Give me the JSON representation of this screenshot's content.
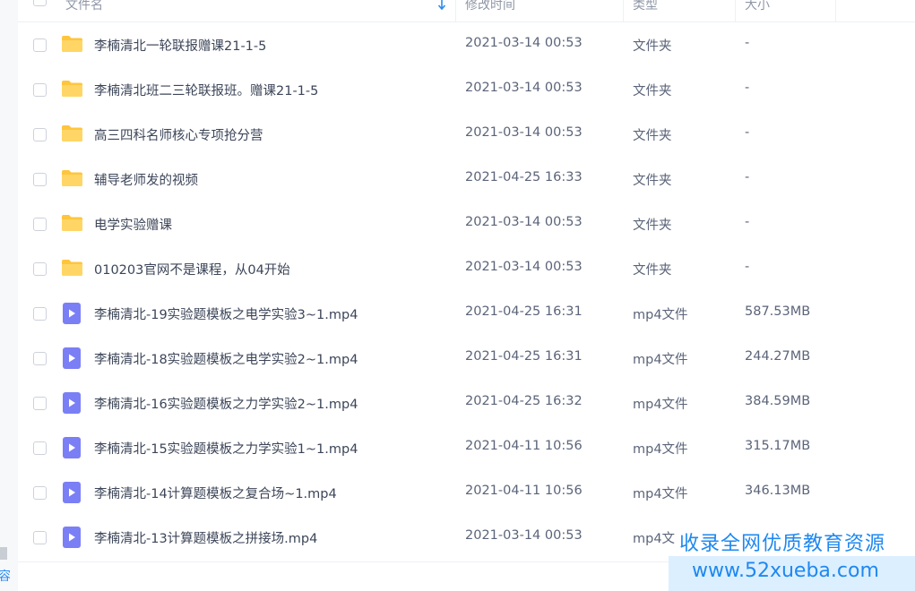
{
  "header": {
    "name_label": "文件名",
    "time_label": "修改时间",
    "type_label": "类型",
    "size_label": "大小",
    "sort_icon": "arrow-down-icon"
  },
  "rows": [
    {
      "name": "李楠清北一轮联报赠课21-1-5",
      "time": "2021-03-14 00:53",
      "type": "文件夹",
      "size": "-",
      "icon": "folder-icon"
    },
    {
      "name": "李楠清北班二三轮联报班。赠课21-1-5",
      "time": "2021-03-14 00:53",
      "type": "文件夹",
      "size": "-",
      "icon": "folder-icon"
    },
    {
      "name": "高三四科名师核心专项抢分营",
      "time": "2021-03-14 00:53",
      "type": "文件夹",
      "size": "-",
      "icon": "folder-icon"
    },
    {
      "name": "辅导老师发的视频",
      "time": "2021-04-25 16:33",
      "type": "文件夹",
      "size": "-",
      "icon": "folder-icon"
    },
    {
      "name": "电学实验赠课",
      "time": "2021-03-14 00:53",
      "type": "文件夹",
      "size": "-",
      "icon": "folder-icon"
    },
    {
      "name": "010203官网不是课程，从04开始",
      "time": "2021-03-14 00:53",
      "type": "文件夹",
      "size": "-",
      "icon": "folder-icon"
    },
    {
      "name": "李楠清北-19实验题模板之电学实验3~1.mp4",
      "time": "2021-04-25 16:31",
      "type": "mp4文件",
      "size": "587.53MB",
      "icon": "video-file-icon"
    },
    {
      "name": "李楠清北-18实验题模板之电学实验2~1.mp4",
      "time": "2021-04-25 16:31",
      "type": "mp4文件",
      "size": "244.27MB",
      "icon": "video-file-icon"
    },
    {
      "name": "李楠清北-16实验题模板之力学实验2~1.mp4",
      "time": "2021-04-25 16:32",
      "type": "mp4文件",
      "size": "384.59MB",
      "icon": "video-file-icon"
    },
    {
      "name": "李楠清北-15实验题模板之力学实验1~1.mp4",
      "time": "2021-04-11 10:56",
      "type": "mp4文件",
      "size": "315.17MB",
      "icon": "video-file-icon"
    },
    {
      "name": "李楠清北-14计算题模板之复合场~1.mp4",
      "time": "2021-04-11 10:56",
      "type": "mp4文件",
      "size": "346.13MB",
      "icon": "video-file-icon"
    },
    {
      "name": "李楠清北-13计算题模板之拼接场.mp4",
      "time": "2021-03-14 00:53",
      "type": "mp4文",
      "size": "",
      "icon": "video-file-icon"
    }
  ],
  "sidebar": {
    "cut_text": "容"
  },
  "watermark": {
    "line1": "收录全网优质教育资源",
    "line2": "www.52xueba.com"
  },
  "colors": {
    "accent": "#2b8cf0",
    "folder": "#ffc53d",
    "video_icon": "#7b7ff5"
  }
}
